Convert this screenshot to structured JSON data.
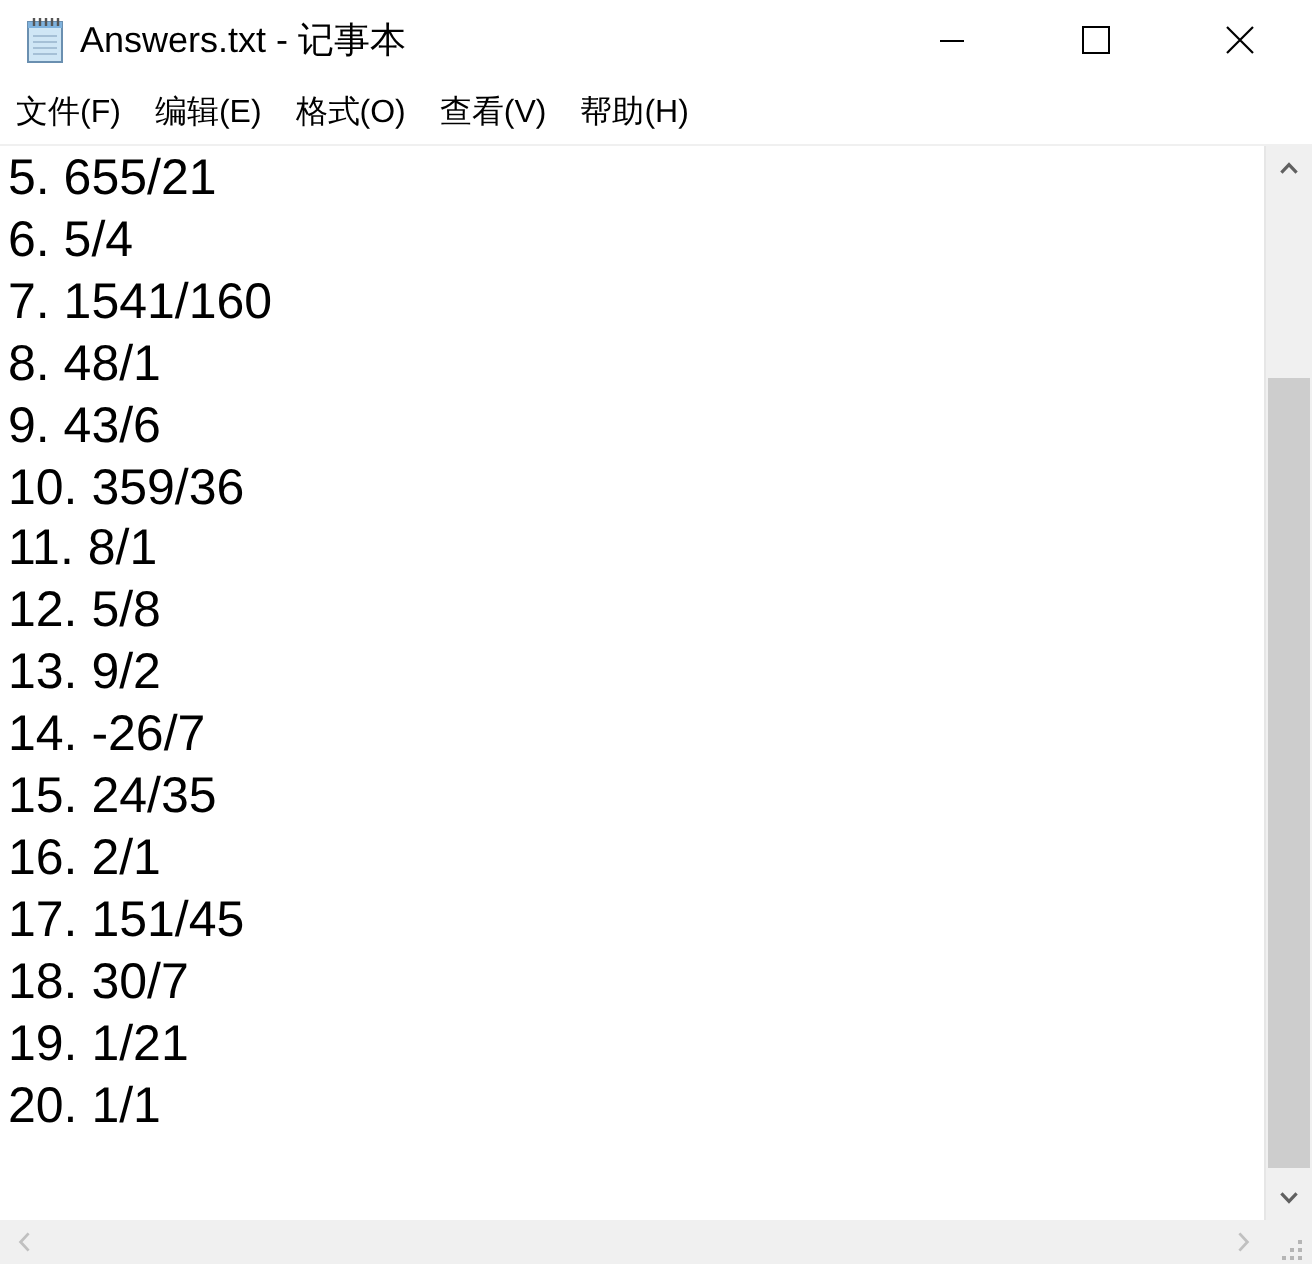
{
  "window": {
    "title": "Answers.txt - 记事本"
  },
  "menu": [
    {
      "label": "文件(F)"
    },
    {
      "label": "编辑(E)"
    },
    {
      "label": "格式(O)"
    },
    {
      "label": "查看(V)"
    },
    {
      "label": "帮助(H)"
    }
  ],
  "editor": {
    "lines": [
      "5. 655/21",
      "6. 5/4",
      "7. 1541/160",
      "8. 48/1",
      "9. 43/6",
      "10. 359/36",
      "11. 8/1",
      "12. 5/8",
      "13. 9/2",
      "14. -26/7",
      "15. 24/35",
      "16. 2/1",
      "17. 151/45",
      "18. 30/7",
      "19. 1/21",
      "20. 1/1"
    ]
  }
}
